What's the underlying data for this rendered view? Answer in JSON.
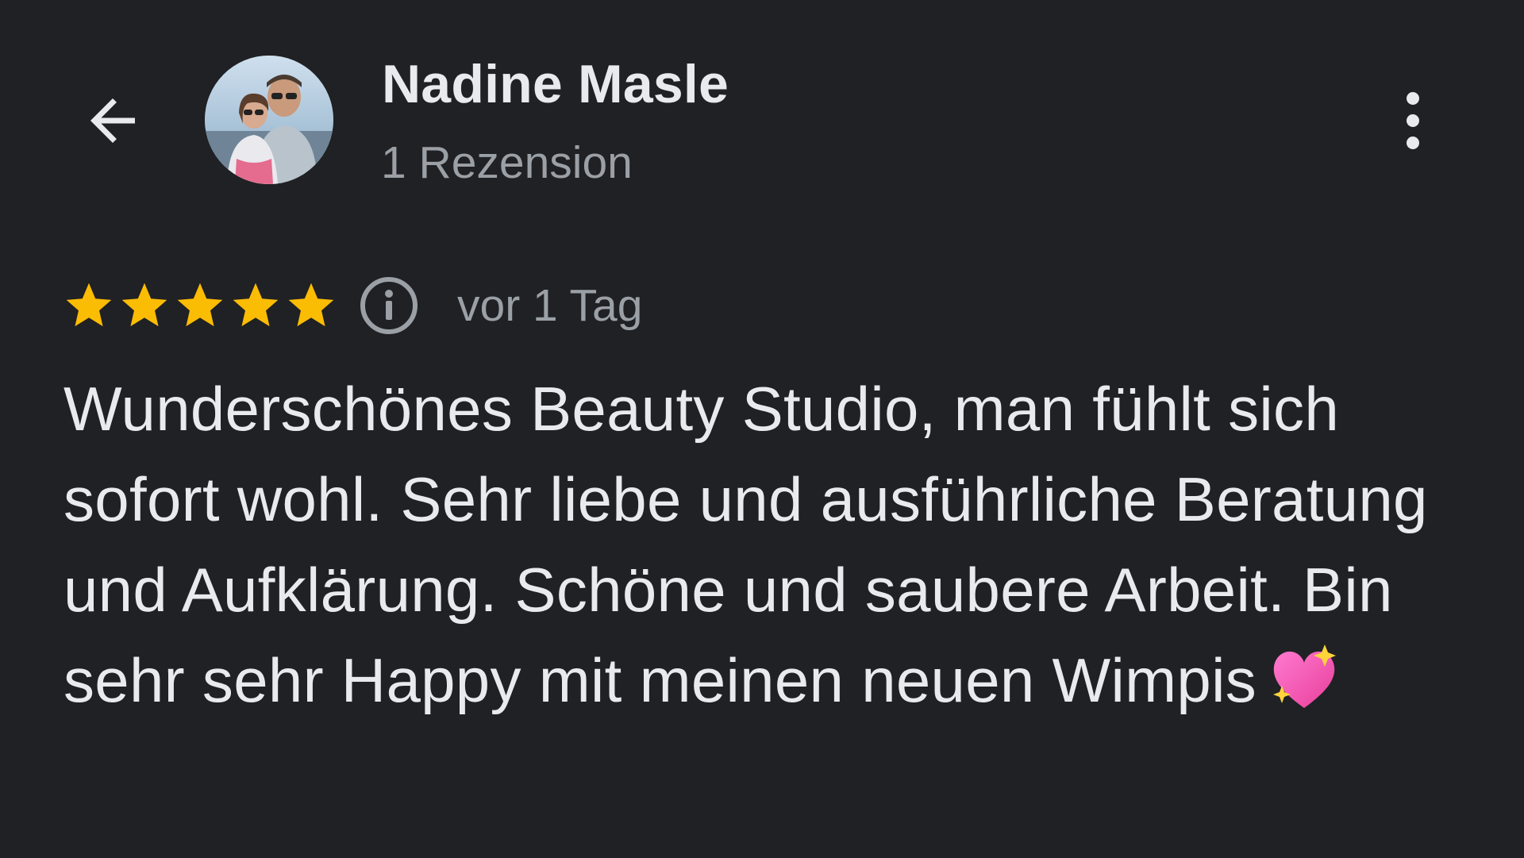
{
  "header": {
    "back_icon": "arrow-left-icon",
    "author_name": "Nadine Masle",
    "review_count": "1 Rezension",
    "more_icon": "more-vert-icon"
  },
  "review": {
    "rating": 5,
    "rating_max": 5,
    "info_icon": "info-icon",
    "date": "vor 1 Tag",
    "text": "Wunderschönes Beauty Studio, man fühlt sich sofort wohl. Sehr liebe und ausführliche Beratung und Aufklärung. Schöne und saubere Arbeit. Bin sehr sehr Happy mit meinen neuen Wimpis",
    "emoji": "sparkling-heart-emoji"
  },
  "colors": {
    "background": "#202124",
    "text_primary": "#e8eaed",
    "text_secondary": "#9aa0a6",
    "star": "#fbbc04"
  }
}
